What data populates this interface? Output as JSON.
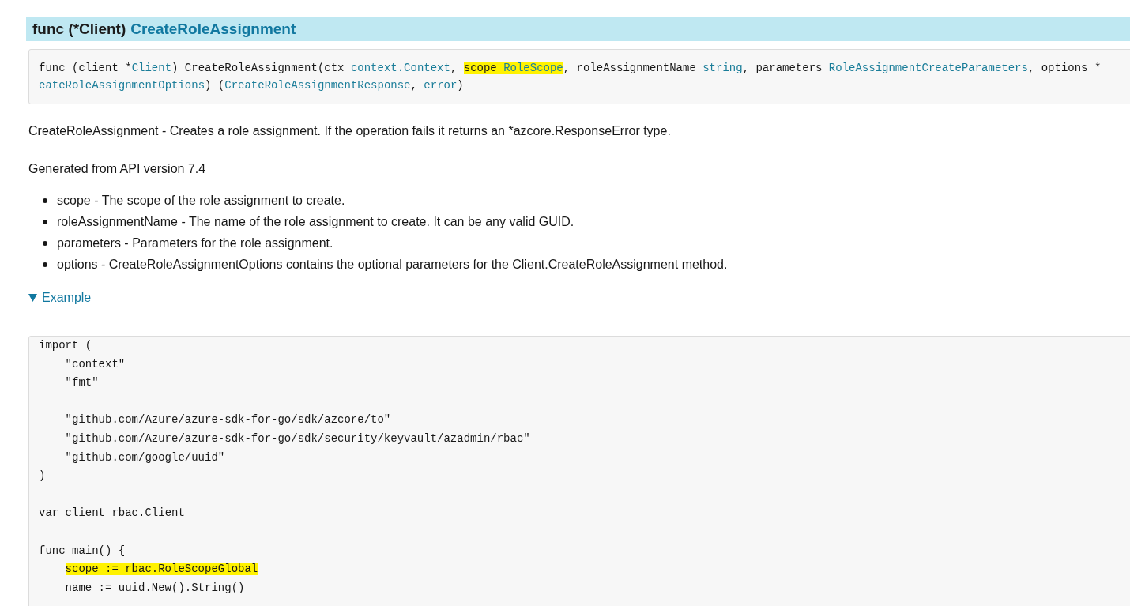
{
  "heading": {
    "prefix": "func (*Client)",
    "name": "CreateRoleAssignment"
  },
  "signature": {
    "lines": [
      [
        {
          "text": "func (client *",
          "kind": "plain",
          "marked": false
        },
        {
          "text": "Client",
          "kind": "type",
          "marked": false
        },
        {
          "text": ") CreateRoleAssignment(ctx ",
          "kind": "plain",
          "marked": false
        },
        {
          "text": "context.Context",
          "kind": "type",
          "marked": false
        },
        {
          "text": ", ",
          "kind": "plain",
          "marked": false
        },
        {
          "text": "scope ",
          "kind": "plain",
          "marked": true
        },
        {
          "text": "RoleScope",
          "kind": "type",
          "marked": true
        },
        {
          "text": ", roleAssignmentName ",
          "kind": "plain",
          "marked": false
        },
        {
          "text": "string",
          "kind": "type",
          "marked": false
        },
        {
          "text": ", parameters ",
          "kind": "plain",
          "marked": false
        },
        {
          "text": "RoleAssignmentCreateParameters",
          "kind": "type",
          "marked": false
        },
        {
          "text": ", options *",
          "kind": "plain",
          "marked": false
        }
      ],
      [
        {
          "text": "eateRoleAssignmentOptions",
          "kind": "type",
          "marked": false
        },
        {
          "text": ") (",
          "kind": "plain",
          "marked": false
        },
        {
          "text": "CreateRoleAssignmentResponse",
          "kind": "type",
          "marked": false
        },
        {
          "text": ", ",
          "kind": "plain",
          "marked": false
        },
        {
          "text": "error",
          "kind": "type",
          "marked": false
        },
        {
          "text": ")",
          "kind": "plain",
          "marked": false
        }
      ]
    ]
  },
  "description": "CreateRoleAssignment - Creates a role assignment. If the operation fails it returns an *azcore.ResponseError type.",
  "generated": "Generated from API version 7.4",
  "params": [
    "scope - The scope of the role assignment to create.",
    "roleAssignmentName - The name of the role assignment to create. It can be any valid GUID.",
    "parameters - Parameters for the role assignment.",
    "options - CreateRoleAssignmentOptions contains the optional parameters for the Client.CreateRoleAssignment method."
  ],
  "example": {
    "label": "Example",
    "expanded": true,
    "code_blocks": [
      [
        {
          "indented": false,
          "text": "import (",
          "marked": false
        },
        {
          "indented": true,
          "text": "\"context\"",
          "marked": false
        },
        {
          "indented": true,
          "text": "\"fmt\"",
          "marked": false
        }
      ],
      [
        {
          "indented": true,
          "text": "\"github.com/Azure/azure-sdk-for-go/sdk/azcore/to\"",
          "marked": false
        },
        {
          "indented": true,
          "text": "\"github.com/Azure/azure-sdk-for-go/sdk/security/keyvault/azadmin/rbac\"",
          "marked": false
        },
        {
          "indented": true,
          "text": "\"github.com/google/uuid\"",
          "marked": false
        },
        {
          "indented": false,
          "text": ")",
          "marked": false
        }
      ],
      [
        {
          "indented": false,
          "text": "var client rbac.Client",
          "marked": false
        }
      ],
      [
        {
          "indented": false,
          "text": "func main() {",
          "marked": false
        },
        {
          "indented": true,
          "text": "scope := rbac.RoleScopeGlobal",
          "marked": true
        },
        {
          "indented": true,
          "text": "name := uuid.New().String()",
          "marked": false
        }
      ]
    ]
  }
}
